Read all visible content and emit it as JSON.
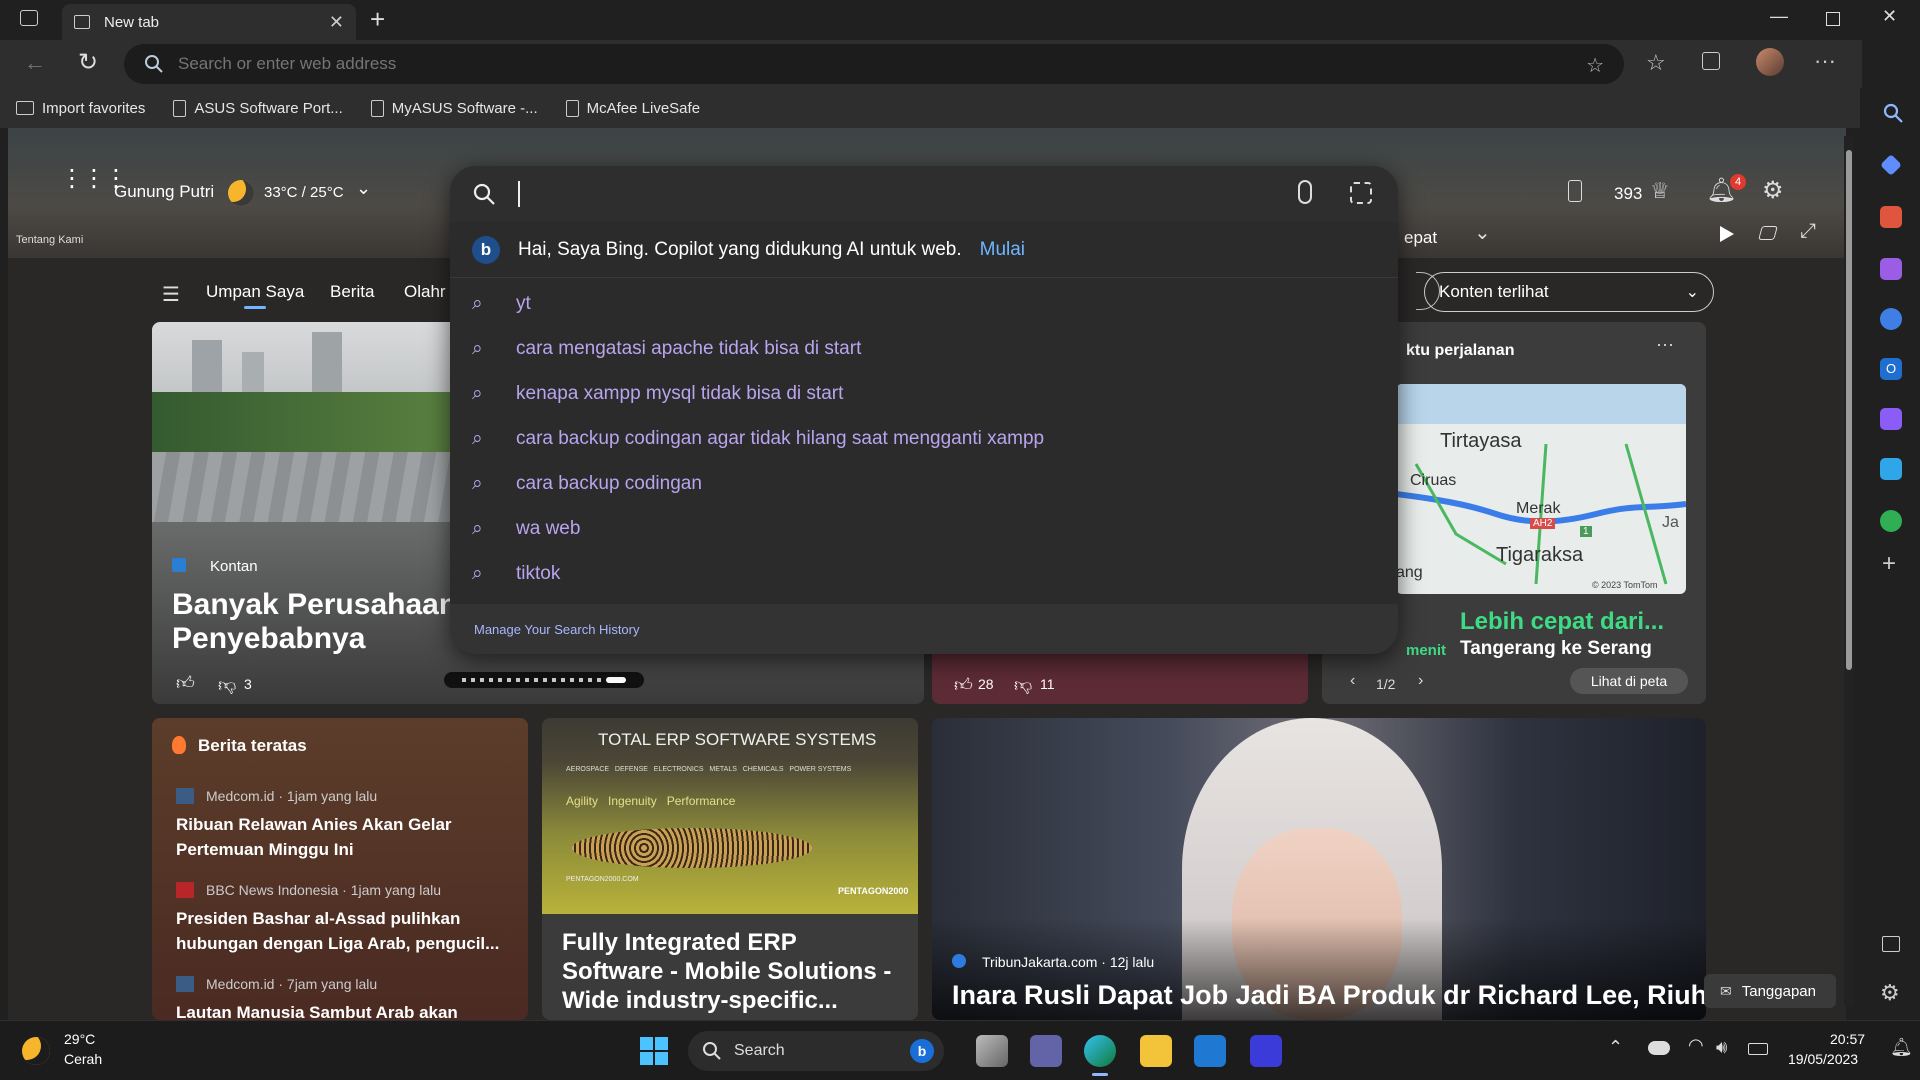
{
  "browser": {
    "tab_title": "New tab",
    "address_placeholder": "Search or enter web address"
  },
  "bookmarks": [
    "Import favorites",
    "ASUS Software Port...",
    "MyASUS Software -...",
    "McAfee LiveSafe"
  ],
  "header": {
    "location": "Gunung Putri",
    "temp_range": "33°C / 25°C",
    "about_link": "Tentang Kami",
    "points": "393",
    "notification_count": "4",
    "quick_label": "epat"
  },
  "nav": {
    "tabs": [
      "Umpan Saya",
      "Berita",
      "Olahr"
    ],
    "content_dropdown": "Konten terlihat"
  },
  "search": {
    "bing_prompt": "Hai, Saya Bing. Copilot yang didukung AI untuk web.",
    "bing_action": "Mulai",
    "suggestions": [
      "yt",
      "cara mengatasi apache tidak bisa di start",
      "kenapa xampp mysql tidak bisa di start",
      "cara backup codingan agar tidak hilang saat mengganti xampp",
      "cara backup codingan",
      "wa web",
      "tiktok"
    ],
    "manage_link": "Manage Your Search History"
  },
  "main_card": {
    "source": "Kontan",
    "title_line1": "Banyak Perusahaan I",
    "title_line2": "Penyebabnya",
    "dislikes": "3"
  },
  "mid_card": {
    "likes": "28",
    "dislikes": "11"
  },
  "travel_card": {
    "header": "ktu perjalanan",
    "map_labels": [
      "Tirtayasa",
      "Ciruas",
      "Merak",
      "Tigaraksa",
      "ang",
      "AH2",
      "1",
      "Ja",
      "© 2023 TomTom"
    ],
    "headline": "Lebih cepat dari...",
    "minutes_label": "menit",
    "route": "Tangerang ke Serang",
    "pager": "1/2",
    "map_button": "Lihat di peta"
  },
  "top_news": {
    "title": "Berita teratas",
    "items": [
      {
        "meta": "Medcom.id · 1jam yang lalu",
        "title": "Ribuan Relawan Anies Akan Gelar Pertemuan Minggu Ini"
      },
      {
        "meta": "BBC News Indonesia · 1jam yang lalu",
        "title": "Presiden Bashar al-Assad pulihkan hubungan dengan Liga Arab, pengucil..."
      },
      {
        "meta": "Medcom.id · 7jam yang lalu",
        "title": "Lautan Manusia Sambut Arab akan"
      }
    ]
  },
  "ad_card": {
    "banner_title": "TOTAL ERP SOFTWARE SYSTEMS",
    "banner_categories": "AEROSPACE   DEFENSE   ELECTRONICS   METALS   CHEMICALS   POWER SYSTEMS",
    "banner_tagline": "Agility   Ingenuity   Performance",
    "banner_brand": "PENTAGON2000",
    "banner_url": "PENTAGON2000.COM",
    "title": "Fully Integrated ERP Software - Mobile Solutions - Wide industry-specific..."
  },
  "feature_card": {
    "source": "TribunJakarta.com · 12j lalu",
    "title": "Inara Rusli Dapat Job Jadi BA Produk dr Richard Lee, Riuh"
  },
  "feedback_button": "Tanggapan",
  "taskbar": {
    "weather_temp": "29°C",
    "weather_desc": "Cerah",
    "search_label": "Search",
    "time": "20:57",
    "date": "19/05/2023"
  },
  "colors": {
    "accent_purple": "#b9a4ee",
    "bing_link": "#6fb6ff",
    "green_route": "#3ddc84",
    "notification_badge": "#e03a2e"
  }
}
